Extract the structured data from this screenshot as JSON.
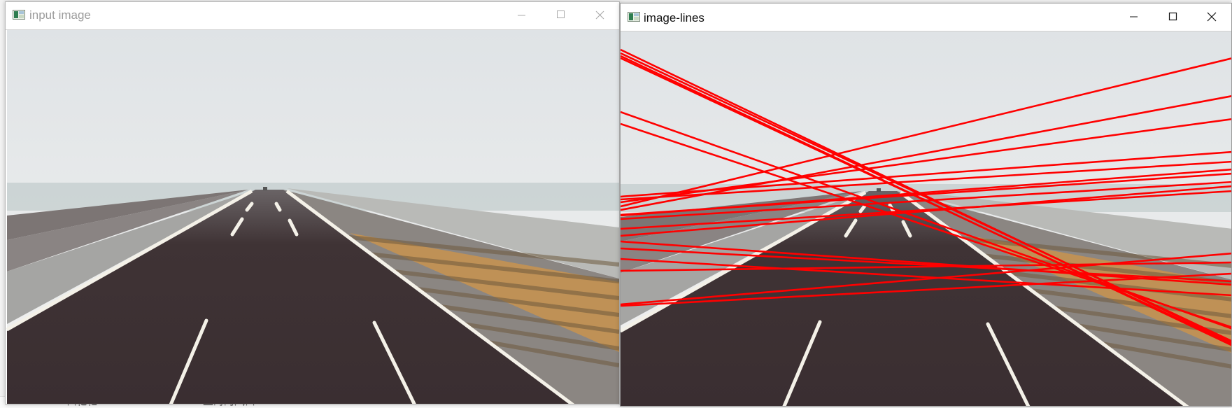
{
  "desktop": {
    "fragment_left": "口忆亿",
    "fragment_right": "上海的风口"
  },
  "windows": [
    {
      "title": "input image",
      "buttons": {
        "minimize": "minimize-icon",
        "maximize": "maximize-icon",
        "close": "close-icon"
      }
    },
    {
      "title": "image-lines",
      "buttons": {
        "minimize": "minimize-icon",
        "maximize": "maximize-icon",
        "close": "close-icon"
      },
      "overlay": {
        "line_color": "#ff0000",
        "line_count": 22
      }
    }
  ],
  "colors": {
    "sky_top": "#dfe3e6",
    "sky_horizon": "#f2f2f0",
    "asphalt": "#3f3335",
    "lane_marking": "#f4f1e8",
    "hatched_shoulder": "#c8934f",
    "sea": "#b7c3c2",
    "detected_line": "#ff0000"
  }
}
